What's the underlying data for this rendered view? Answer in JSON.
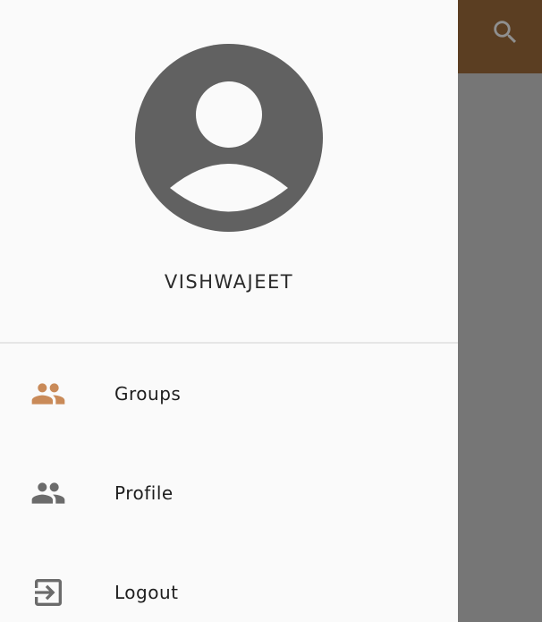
{
  "app": {
    "toolbar_color": "#5b3e22",
    "search_icon": "search-icon"
  },
  "drawer": {
    "user": {
      "avatar_icon": "account-circle-icon",
      "name": "VISHWAJEET"
    },
    "items": [
      {
        "label": "Groups",
        "icon": "group-icon",
        "icon_color": "#c98a58",
        "selected": true
      },
      {
        "label": "Profile",
        "icon": "group-icon",
        "icon_color": "#6b6b6b",
        "selected": false
      },
      {
        "label": "Logout",
        "icon": "exit-to-app-icon",
        "icon_color": "#6b6b6b",
        "selected": false
      }
    ]
  },
  "colors": {
    "accent": "#c98a58",
    "toolbar": "#5b3e22",
    "drawer_bg": "#fafafa",
    "scrim": "#767676",
    "avatar": "#616161"
  }
}
